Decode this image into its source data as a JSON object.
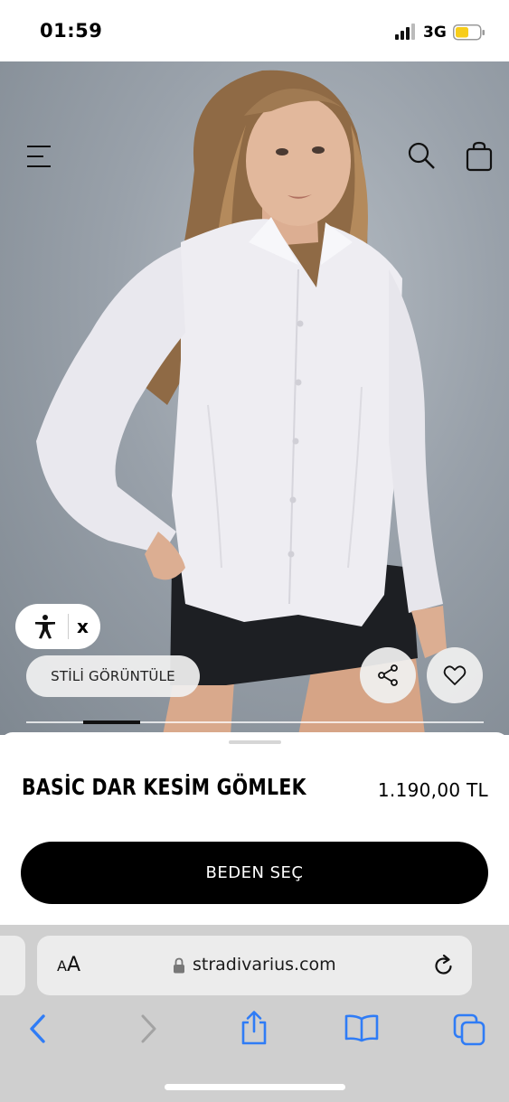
{
  "status_bar": {
    "time": "01:59",
    "network": "3G",
    "battery_color": "#f7cd1a"
  },
  "header": {
    "menu_icon": "hamburger-menu-icon",
    "search_icon": "search-icon",
    "bag_icon": "shopping-bag-icon"
  },
  "gallery": {
    "accessibility_close": "x",
    "style_button_label": "STİLİ GÖRÜNTÜLE",
    "share_icon": "share-icon",
    "favorite_icon": "heart-icon",
    "progress": 0.125
  },
  "product": {
    "title": "BASİC DAR KESİM GÖMLEK",
    "price": "1.190,00 TL",
    "size_button_label": "BEDEN SEÇ"
  },
  "browser": {
    "text_size_small": "A",
    "text_size_big": "A",
    "url": "stradivarius.com",
    "accent_color": "#2f7cf6"
  }
}
